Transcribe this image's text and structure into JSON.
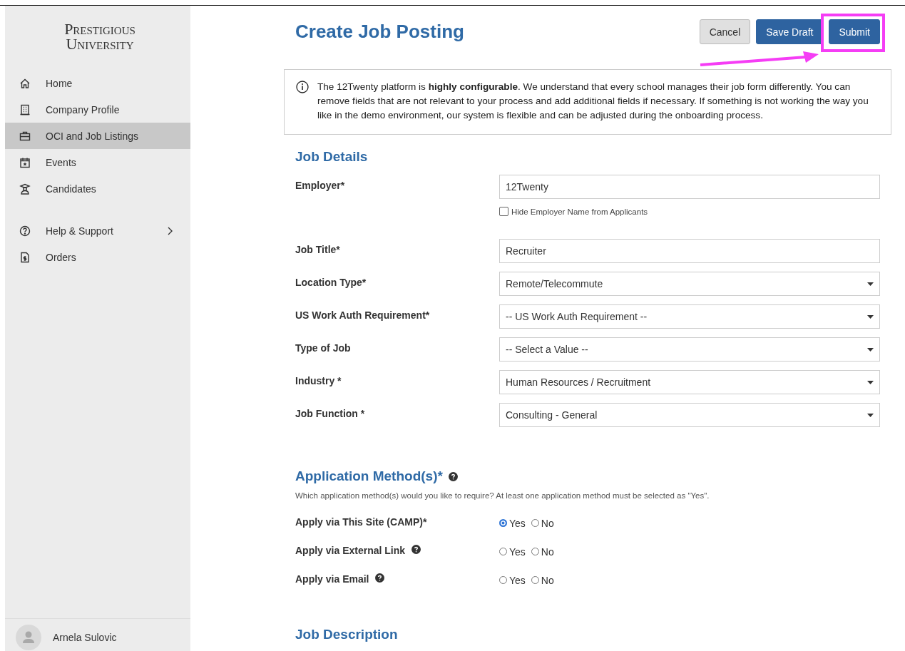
{
  "sidebar": {
    "logo": [
      "Prestigious",
      "University"
    ],
    "items": [
      {
        "label": "Home",
        "selected": false
      },
      {
        "label": "Company Profile",
        "selected": false
      },
      {
        "label": "OCI and Job Listings",
        "selected": true
      },
      {
        "label": "Events",
        "selected": false
      },
      {
        "label": "Candidates",
        "selected": false
      }
    ],
    "secondary_items": [
      {
        "label": "Help & Support",
        "selected": false,
        "has_submenu": true
      },
      {
        "label": "Orders",
        "selected": false,
        "has_submenu": false
      }
    ],
    "user": {
      "name": "Arnela Sulovic"
    }
  },
  "header": {
    "title": "Create Job Posting",
    "buttons": [
      {
        "label": "Cancel",
        "kind": "secondary"
      },
      {
        "label": "Save Draft",
        "kind": "primary"
      },
      {
        "label": "Submit",
        "kind": "primary"
      }
    ]
  },
  "notice": {
    "text": "The 12Twenty platform is **highly configurable**. We understand that every school manages their job form differently. You can remove fields that are not relevant to your process and add additional fields if necessary. If something is not working the way you like in the demo environment, our system is flexible and can be adjusted during the onboarding process."
  },
  "job_details": {
    "title": "Job Details",
    "fields": [
      {
        "label": "Employer*",
        "kind": "text",
        "value": "12Twenty",
        "checkbox": {
          "label": "Hide Employer Name from Applicants",
          "checked": false
        }
      },
      {
        "label": "Job Title*",
        "kind": "text",
        "value": "Recruiter"
      },
      {
        "label": "Location Type*",
        "kind": "select",
        "value": "Remote/Telecommute"
      },
      {
        "label": "US Work Auth Requirement*",
        "kind": "select",
        "value": "-- US Work Auth Requirement --"
      },
      {
        "label": "Type of Job",
        "kind": "select",
        "value": "-- Select a Value --"
      },
      {
        "label": "Industry *",
        "kind": "select",
        "value": "Human Resources / Recruitment"
      },
      {
        "label": "Job Function *",
        "kind": "select",
        "value": "Consulting - General"
      }
    ]
  },
  "application_methods": {
    "title": "Application Method(s)*",
    "has_help": true,
    "description": "Which application method(s) would you like to require? At least one application method must be selected as \"Yes\".",
    "methods": [
      {
        "label": "Apply via This Site (CAMP)*",
        "has_help": false,
        "options": [
          {
            "label": "Yes",
            "selected": true
          },
          {
            "label": "No",
            "selected": false
          }
        ]
      },
      {
        "label": "Apply via External Link",
        "has_help": true,
        "options": [
          {
            "label": "Yes",
            "selected": false
          },
          {
            "label": "No",
            "selected": false
          }
        ]
      },
      {
        "label": "Apply via Email",
        "has_help": true,
        "options": [
          {
            "label": "Yes",
            "selected": false
          },
          {
            "label": "No",
            "selected": false
          }
        ]
      }
    ]
  },
  "next_section": {
    "title": "Job Description"
  },
  "annotations": {
    "submit_highlight": true,
    "pointer_arrow": true
  }
}
